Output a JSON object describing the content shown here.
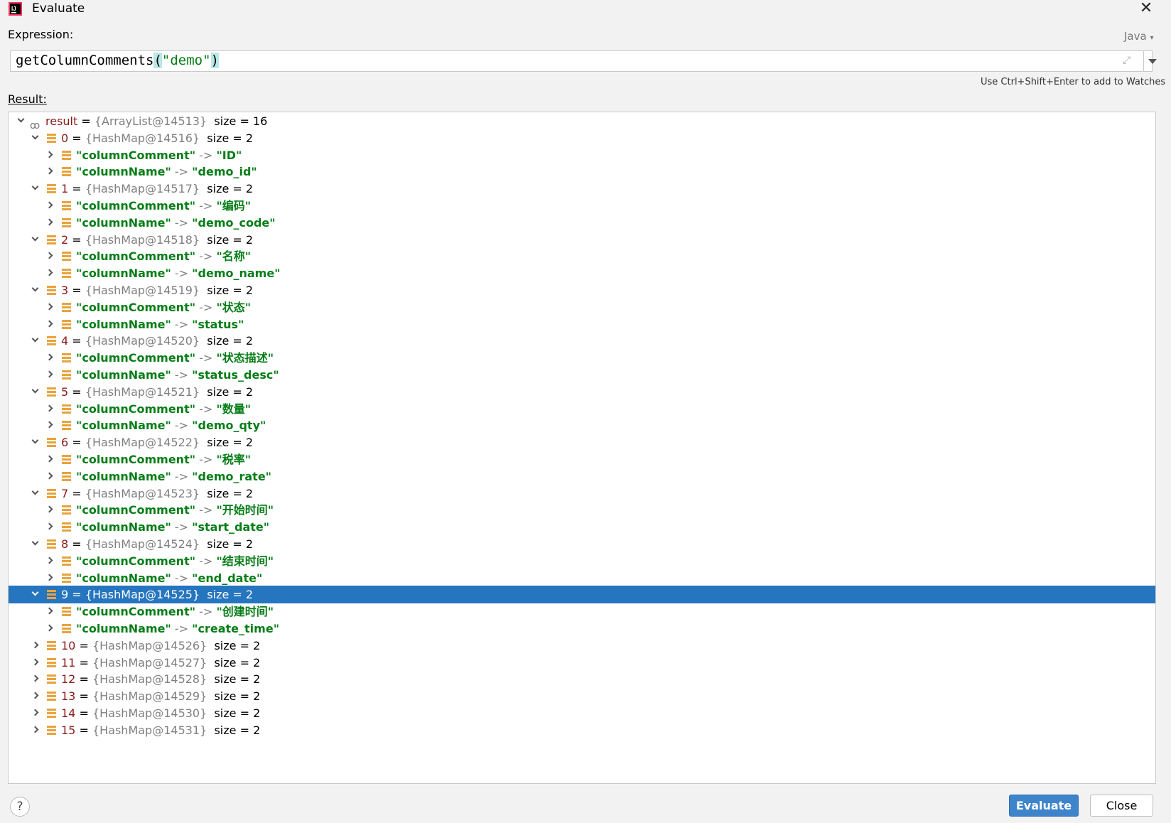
{
  "window": {
    "title": "Evaluate"
  },
  "expression": {
    "label": "Expression:",
    "language": "Java",
    "func": "getColumnComments",
    "open_paren": "(",
    "arg": "\"demo\"",
    "close_paren": ")"
  },
  "hint": "Use Ctrl+Shift+Enter to add to Watches",
  "result_label": "Result:",
  "tree": {
    "root": {
      "name": "result",
      "eq": "=",
      "ref": "{ArrayList@14513}",
      "size": "size = 16"
    },
    "rows": [
      {
        "level": 1,
        "kind": "map",
        "expanded": true,
        "idx": "0",
        "ref": "{HashMap@14516}",
        "size": "size = 2"
      },
      {
        "level": 2,
        "kind": "entry",
        "key": "\"columnComment\"",
        "val": "\"ID\""
      },
      {
        "level": 2,
        "kind": "entry",
        "key": "\"columnName\"",
        "val": "\"demo_id\""
      },
      {
        "level": 1,
        "kind": "map",
        "expanded": true,
        "idx": "1",
        "ref": "{HashMap@14517}",
        "size": "size = 2"
      },
      {
        "level": 2,
        "kind": "entry",
        "key": "\"columnComment\"",
        "val": "\"编码\""
      },
      {
        "level": 2,
        "kind": "entry",
        "key": "\"columnName\"",
        "val": "\"demo_code\""
      },
      {
        "level": 1,
        "kind": "map",
        "expanded": true,
        "idx": "2",
        "ref": "{HashMap@14518}",
        "size": "size = 2"
      },
      {
        "level": 2,
        "kind": "entry",
        "key": "\"columnComment\"",
        "val": "\"名称\""
      },
      {
        "level": 2,
        "kind": "entry",
        "key": "\"columnName\"",
        "val": "\"demo_name\""
      },
      {
        "level": 1,
        "kind": "map",
        "expanded": true,
        "idx": "3",
        "ref": "{HashMap@14519}",
        "size": "size = 2"
      },
      {
        "level": 2,
        "kind": "entry",
        "key": "\"columnComment\"",
        "val": "\"状态\""
      },
      {
        "level": 2,
        "kind": "entry",
        "key": "\"columnName\"",
        "val": "\"status\""
      },
      {
        "level": 1,
        "kind": "map",
        "expanded": true,
        "idx": "4",
        "ref": "{HashMap@14520}",
        "size": "size = 2"
      },
      {
        "level": 2,
        "kind": "entry",
        "key": "\"columnComment\"",
        "val": "\"状态描述\""
      },
      {
        "level": 2,
        "kind": "entry",
        "key": "\"columnName\"",
        "val": "\"status_desc\""
      },
      {
        "level": 1,
        "kind": "map",
        "expanded": true,
        "idx": "5",
        "ref": "{HashMap@14521}",
        "size": "size = 2"
      },
      {
        "level": 2,
        "kind": "entry",
        "key": "\"columnComment\"",
        "val": "\"数量\""
      },
      {
        "level": 2,
        "kind": "entry",
        "key": "\"columnName\"",
        "val": "\"demo_qty\""
      },
      {
        "level": 1,
        "kind": "map",
        "expanded": true,
        "idx": "6",
        "ref": "{HashMap@14522}",
        "size": "size = 2"
      },
      {
        "level": 2,
        "kind": "entry",
        "key": "\"columnComment\"",
        "val": "\"税率\""
      },
      {
        "level": 2,
        "kind": "entry",
        "key": "\"columnName\"",
        "val": "\"demo_rate\""
      },
      {
        "level": 1,
        "kind": "map",
        "expanded": true,
        "idx": "7",
        "ref": "{HashMap@14523}",
        "size": "size = 2"
      },
      {
        "level": 2,
        "kind": "entry",
        "key": "\"columnComment\"",
        "val": "\"开始时间\""
      },
      {
        "level": 2,
        "kind": "entry",
        "key": "\"columnName\"",
        "val": "\"start_date\""
      },
      {
        "level": 1,
        "kind": "map",
        "expanded": true,
        "idx": "8",
        "ref": "{HashMap@14524}",
        "size": "size = 2"
      },
      {
        "level": 2,
        "kind": "entry",
        "key": "\"columnComment\"",
        "val": "\"结束时间\""
      },
      {
        "level": 2,
        "kind": "entry",
        "key": "\"columnName\"",
        "val": "\"end_date\""
      },
      {
        "level": 1,
        "kind": "map",
        "expanded": true,
        "selected": true,
        "idx": "9",
        "ref": "{HashMap@14525}",
        "size": "size = 2"
      },
      {
        "level": 2,
        "kind": "entry",
        "key": "\"columnComment\"",
        "val": "\"创建时间\""
      },
      {
        "level": 2,
        "kind": "entry",
        "key": "\"columnName\"",
        "val": "\"create_time\""
      },
      {
        "level": 1,
        "kind": "map",
        "expanded": false,
        "idx": "10",
        "ref": "{HashMap@14526}",
        "size": "size = 2"
      },
      {
        "level": 1,
        "kind": "map",
        "expanded": false,
        "idx": "11",
        "ref": "{HashMap@14527}",
        "size": "size = 2"
      },
      {
        "level": 1,
        "kind": "map",
        "expanded": false,
        "idx": "12",
        "ref": "{HashMap@14528}",
        "size": "size = 2"
      },
      {
        "level": 1,
        "kind": "map",
        "expanded": false,
        "idx": "13",
        "ref": "{HashMap@14529}",
        "size": "size = 2"
      },
      {
        "level": 1,
        "kind": "map",
        "expanded": false,
        "idx": "14",
        "ref": "{HashMap@14530}",
        "size": "size = 2"
      },
      {
        "level": 1,
        "kind": "map",
        "expanded": false,
        "idx": "15",
        "ref": "{HashMap@14531}",
        "size": "size = 2"
      }
    ],
    "eq": "=",
    "arrow": "->"
  },
  "buttons": {
    "help": "?",
    "evaluate": "Evaluate",
    "close": "Close"
  },
  "colors": {
    "selection": "#2675bf",
    "string_green": "#067d17",
    "index_red": "#8b1a1a",
    "ref_gray": "#808080",
    "primary_button": "#3d84cb"
  }
}
